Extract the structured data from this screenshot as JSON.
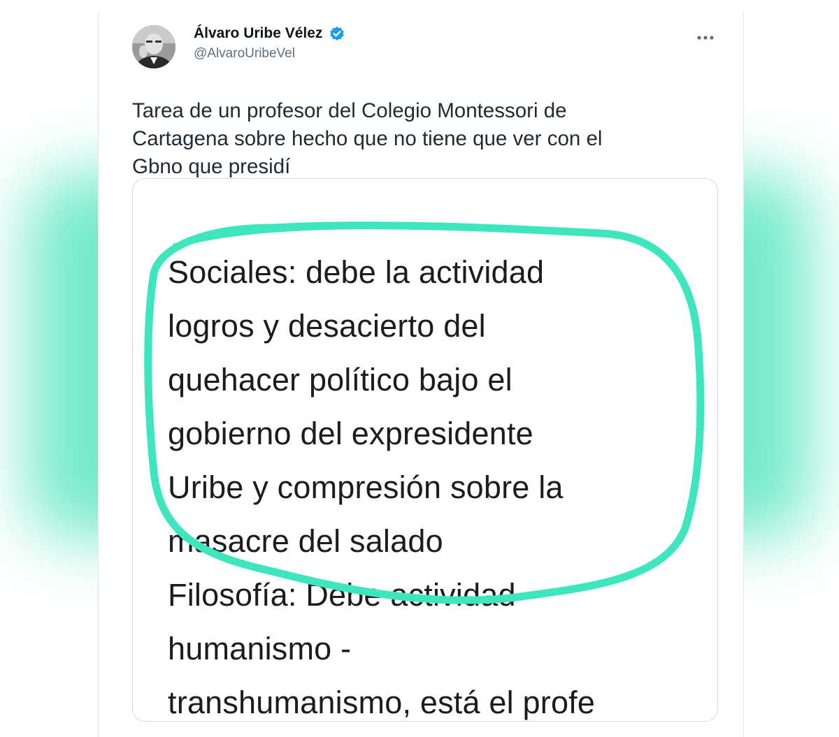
{
  "tweet": {
    "author_name": "Álvaro Uribe Vélez",
    "author_handle": "@AlvaroUribeVel",
    "text_lines": [
      "Tarea de un profesor del Colegio Montessori de",
      "Cartagena sobre hecho que no tiene que ver con el",
      "Gbno que presidí"
    ],
    "icons": {
      "verified": "verified-badge-icon",
      "more": "more-options-icon"
    },
    "accent_color": "#1d9bf0"
  },
  "media": {
    "lines": [
      "Sociales: debe  la actividad",
      "logros y desacierto del",
      "quehacer político bajo el",
      "gobierno del expresidente",
      "Uribe y compresión sobre la",
      "masacre del salado",
      "Filosofía:  Debe actividad",
      "humanismo -",
      "transhumanismo, está el profe"
    ],
    "highlight_color": "#3ee6bd"
  },
  "backdrop": {
    "glow_color": "#63e8c3"
  }
}
